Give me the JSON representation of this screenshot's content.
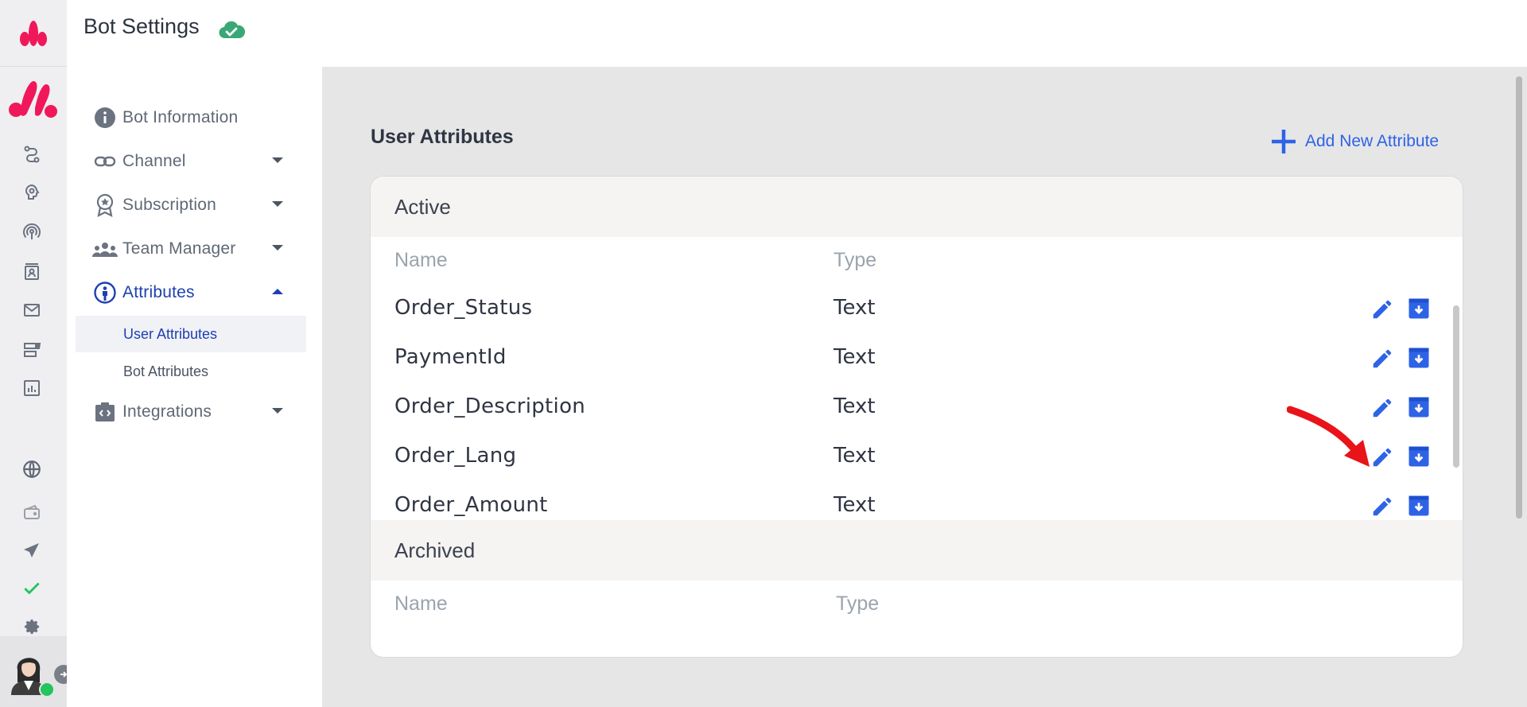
{
  "header": {
    "title": "Bot Settings"
  },
  "nav": {
    "items": [
      {
        "label": "Bot Information",
        "icon": "info-icon",
        "expandable": false
      },
      {
        "label": "Channel",
        "icon": "link-icon",
        "expandable": true
      },
      {
        "label": "Subscription",
        "icon": "badge-icon",
        "expandable": true
      },
      {
        "label": "Team Manager",
        "icon": "team-icon",
        "expandable": true
      },
      {
        "label": "Attributes",
        "icon": "person-icon",
        "expandable": true,
        "expanded": true,
        "active": true
      },
      {
        "label": "Integrations",
        "icon": "integrations-icon",
        "expandable": true
      }
    ],
    "sub_items": [
      {
        "label": "User Attributes",
        "selected": true
      },
      {
        "label": "Bot Attributes",
        "selected": false
      }
    ]
  },
  "rail": {
    "icons": [
      "flow-icon",
      "brain-icon",
      "broadcast-icon",
      "contacts-icon",
      "mail-icon",
      "dashboard-icon",
      "analytics-icon",
      "globe-icon",
      "wallet-icon",
      "send-icon",
      "check-icon",
      "settings-icon"
    ]
  },
  "main": {
    "section_title": "User Attributes",
    "add_button_label": "Add New Attribute",
    "active": {
      "title": "Active",
      "columns": [
        "Name",
        "Type"
      ],
      "rows": [
        {
          "name": "Order_Status",
          "type": "Text"
        },
        {
          "name": "PaymentId",
          "type": "Text"
        },
        {
          "name": "Order_Description",
          "type": "Text"
        },
        {
          "name": "Order_Lang",
          "type": "Text"
        },
        {
          "name": "Order_Amount",
          "type": "Text"
        }
      ]
    },
    "archived": {
      "title": "Archived",
      "columns": [
        "Name",
        "Type"
      ]
    }
  },
  "colors": {
    "accent": "#2f63e6",
    "brand": "#f0185a",
    "nav_active": "#1e40af",
    "success": "#22c55e",
    "annotation": "#e8141a"
  }
}
